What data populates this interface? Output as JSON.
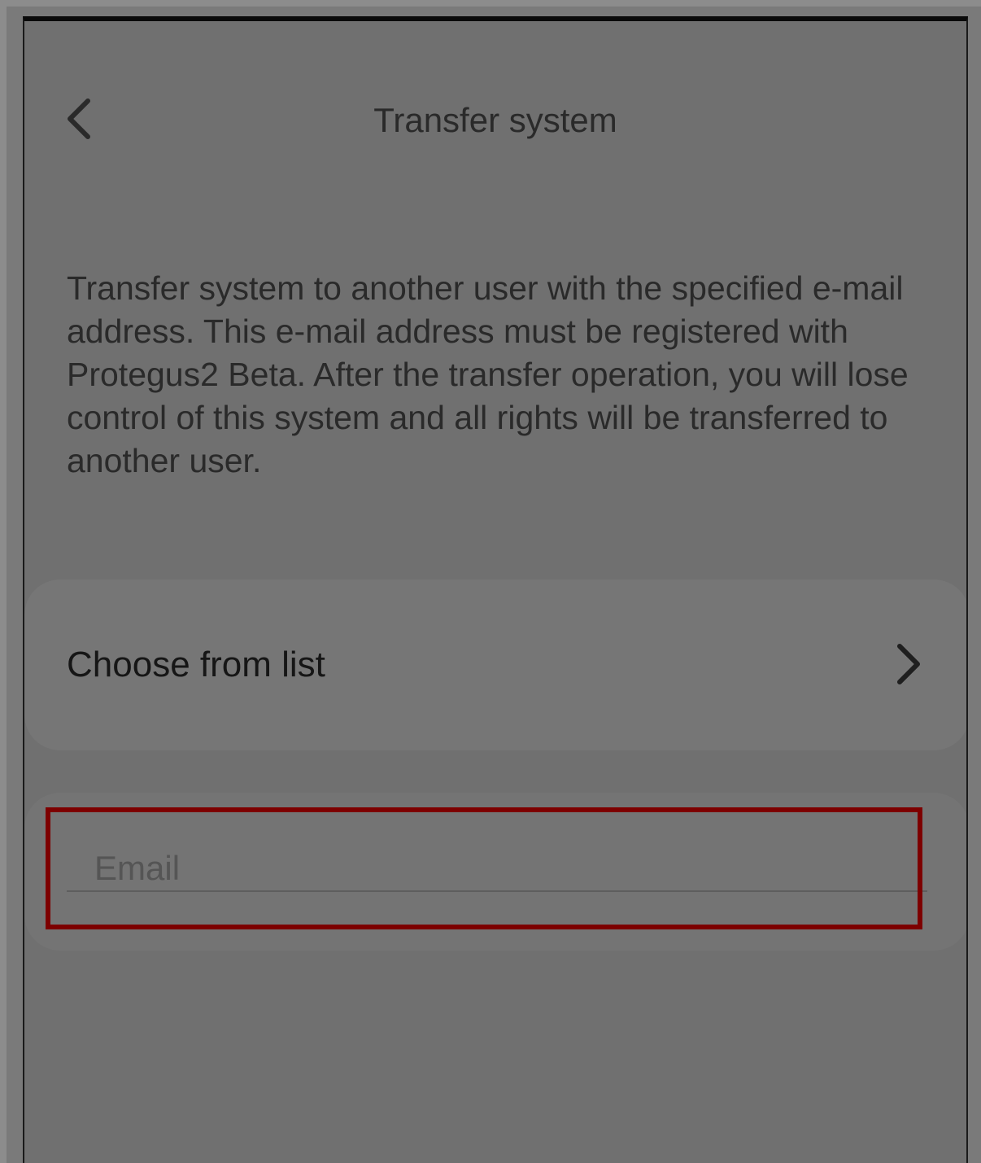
{
  "header": {
    "title": "Transfer system",
    "back_icon": "chevron-left-icon"
  },
  "description": "Transfer system to another user with the specified e-mail address. This e-mail address must be registered with Protegus2 Beta. After the transfer operation, you will lose control of this system and all rights will be transferred to another user.",
  "choose": {
    "label": "Choose from list",
    "icon": "chevron-right-icon"
  },
  "email": {
    "placeholder": "Email",
    "value": ""
  },
  "colors": {
    "highlight": "#7d0000",
    "overlay": "#707070"
  }
}
